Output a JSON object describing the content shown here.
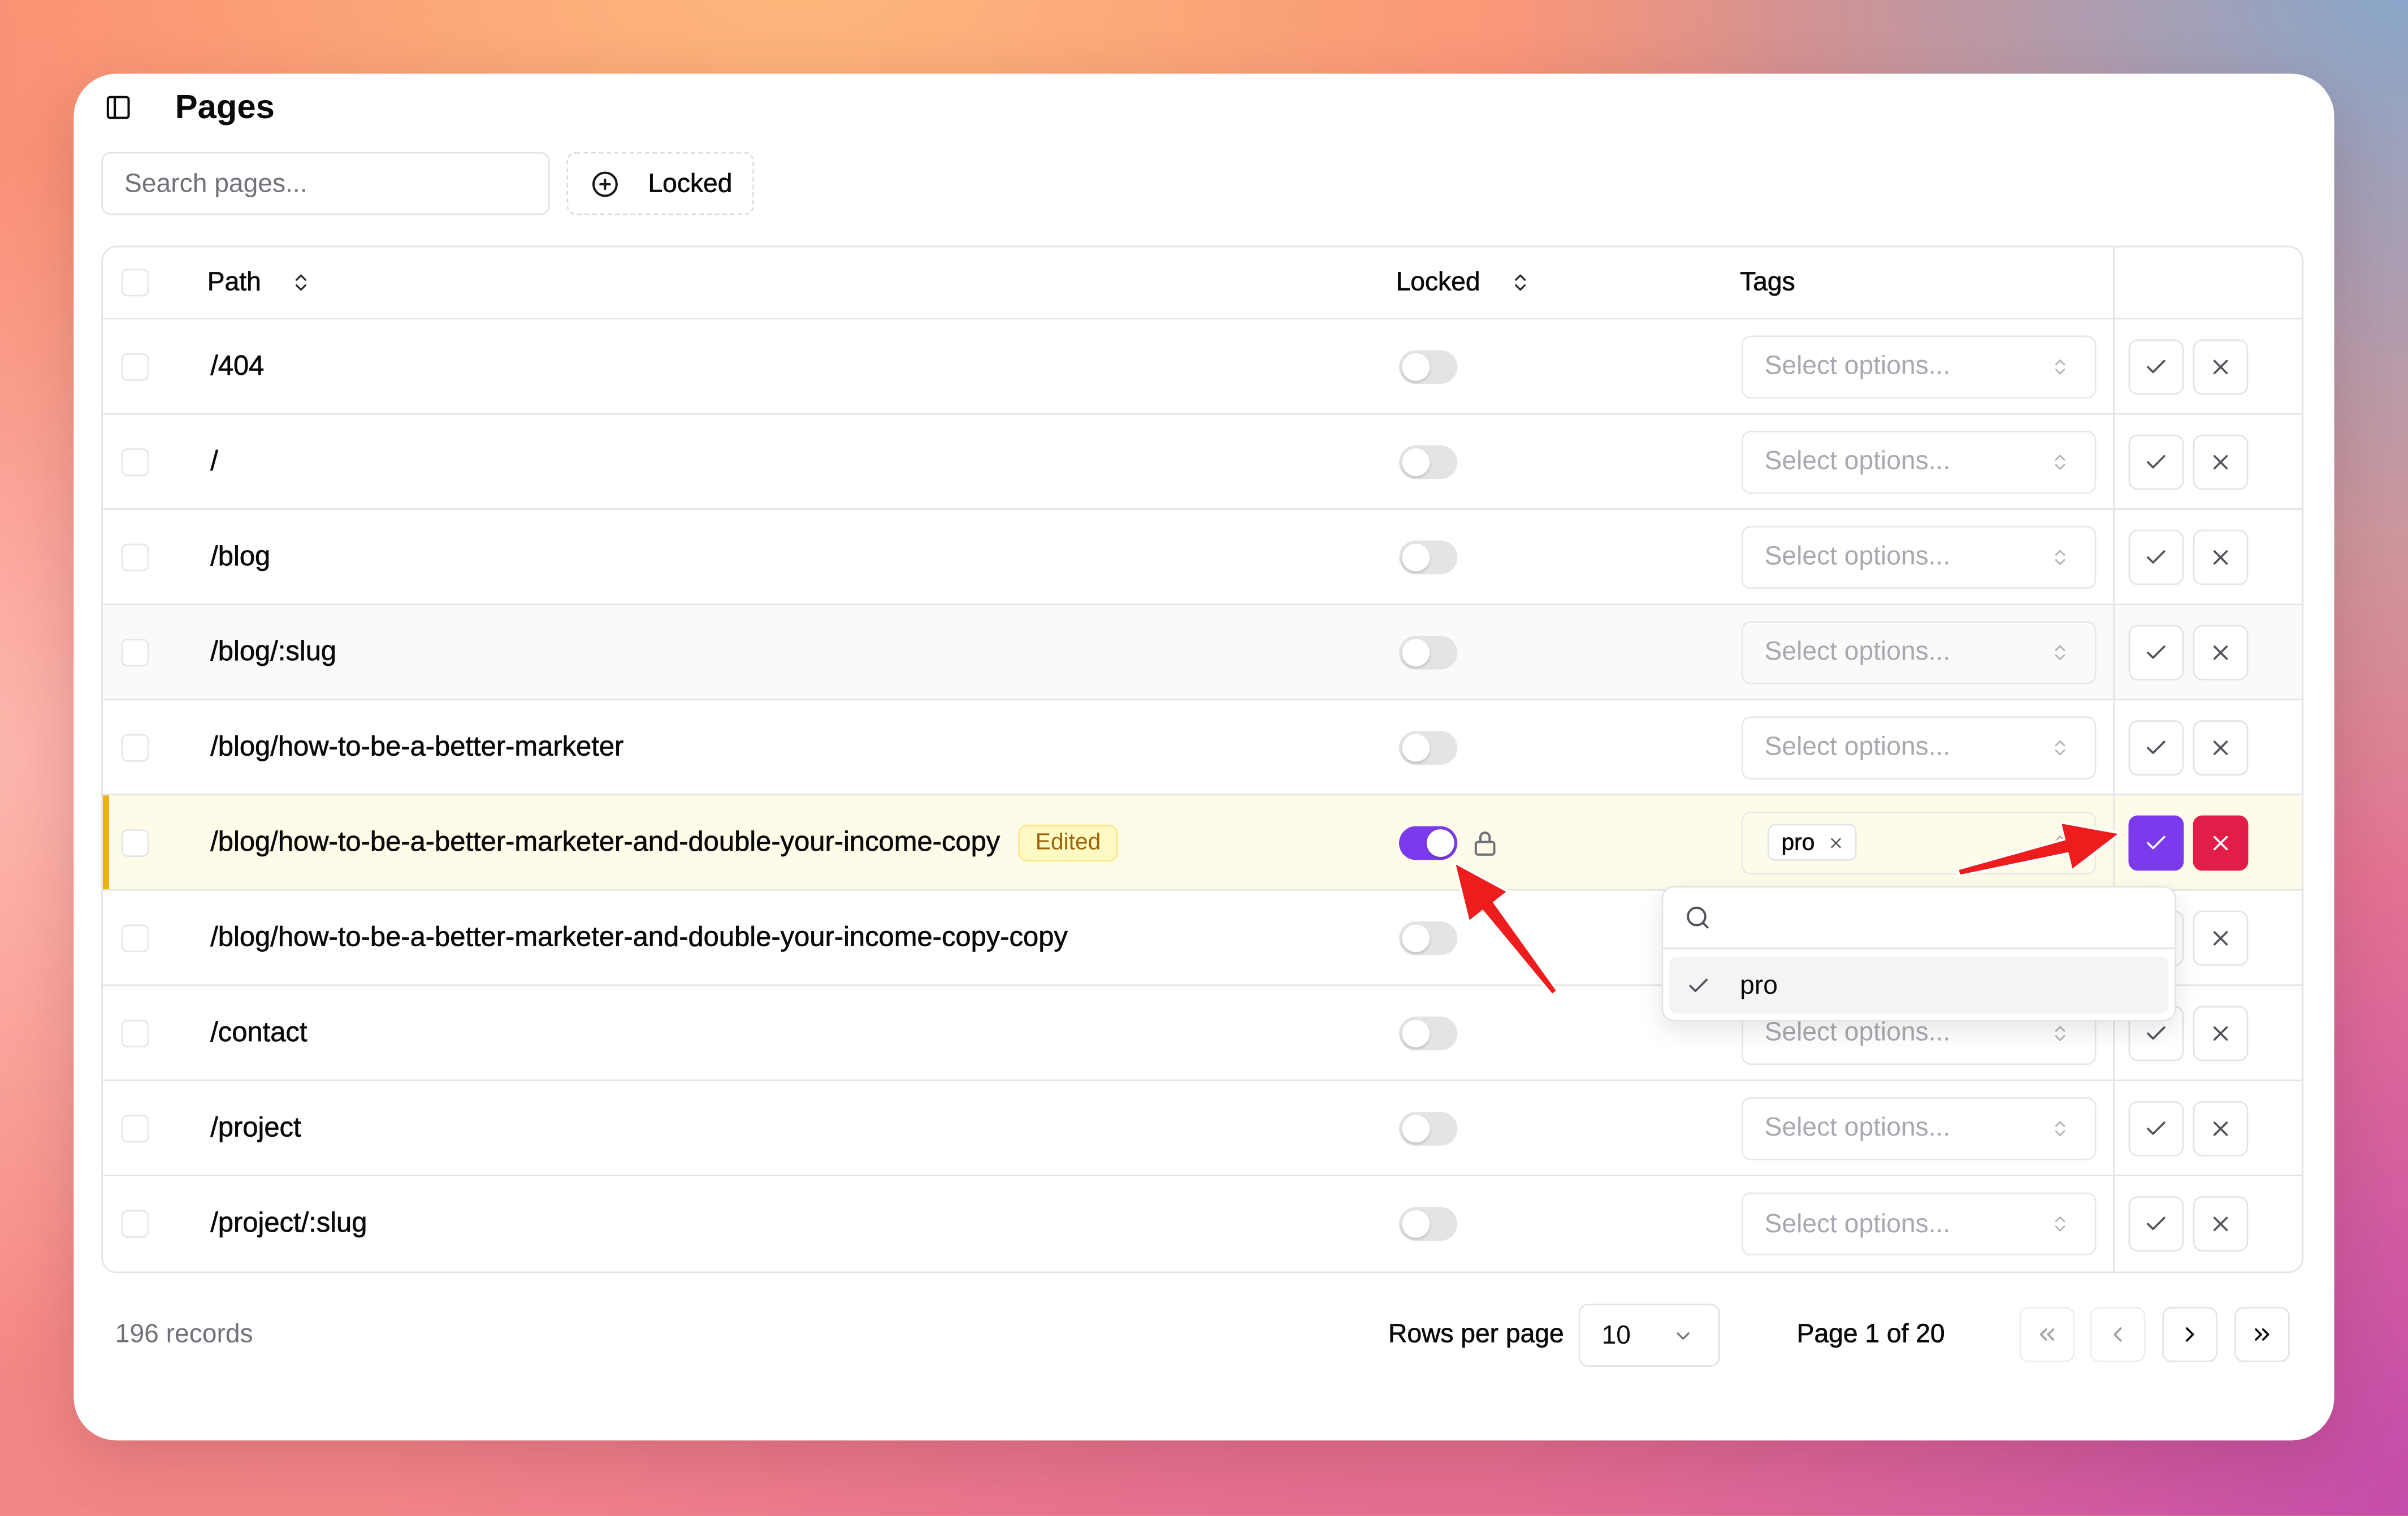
{
  "app": {
    "title": "Pages",
    "sidebar_toggle_icon": "panel-left-icon"
  },
  "toolbar": {
    "search": {
      "placeholder": "Search pages...",
      "value": ""
    },
    "filter": {
      "label": "Locked",
      "icon": "circle-plus-icon"
    }
  },
  "table": {
    "columns": {
      "path": "Path",
      "locked": "Locked",
      "tags": "Tags"
    },
    "tags_placeholder": "Select options...",
    "rows": [
      {
        "path": "/404",
        "locked": false
      },
      {
        "path": "/",
        "locked": false
      },
      {
        "path": "/blog",
        "locked": false
      },
      {
        "path": "/blog/:slug",
        "locked": false,
        "hovered": true
      },
      {
        "path": "/blog/how-to-be-a-better-marketer",
        "locked": false
      },
      {
        "path": "/blog/how-to-be-a-better-marketer-and-double-your-income-copy",
        "locked": true,
        "edited": true,
        "badge": "Edited",
        "tags": [
          "pro"
        ]
      },
      {
        "path": "/blog/how-to-be-a-better-marketer-and-double-your-income-copy-copy",
        "locked": false
      },
      {
        "path": "/contact",
        "locked": false
      },
      {
        "path": "/project",
        "locked": false
      },
      {
        "path": "/project/:slug",
        "locked": false
      }
    ]
  },
  "tags_dropdown": {
    "open": true,
    "search_value": "",
    "options": [
      {
        "label": "pro",
        "selected": true,
        "highlighted": true
      }
    ]
  },
  "footer": {
    "records": "196 records",
    "rows_per_page_label": "Rows per page",
    "rows_per_page_value": "10",
    "page_info": "Page 1 of 20",
    "pagination": {
      "first_enabled": false,
      "previous_enabled": false,
      "next_enabled": true,
      "last_enabled": true
    }
  },
  "colors": {
    "accent": "#7c3aed",
    "danger": "#e11d48",
    "edited_bar": "#eab308",
    "edited_row_bg": "#fefce8",
    "annotation": "#ee1d1d"
  }
}
